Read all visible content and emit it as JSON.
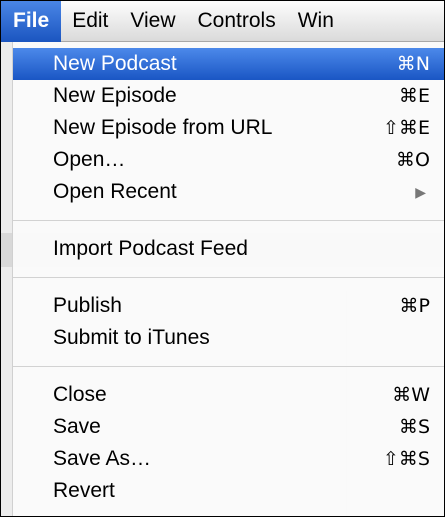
{
  "menubar": {
    "items": [
      {
        "label": "File",
        "active": true
      },
      {
        "label": "Edit",
        "active": false
      },
      {
        "label": "View",
        "active": false
      },
      {
        "label": "Controls",
        "active": false
      },
      {
        "label": "Win",
        "active": false
      }
    ]
  },
  "file_menu": {
    "groups": [
      [
        {
          "label": "New Podcast",
          "shortcut": "⌘N",
          "highlighted": true
        },
        {
          "label": "New Episode",
          "shortcut": "⌘E"
        },
        {
          "label": "New Episode from URL",
          "shortcut": "⇧⌘E"
        },
        {
          "label": "Open…",
          "shortcut": "⌘O"
        },
        {
          "label": "Open Recent",
          "submenu": true,
          "shortcut": "▶"
        }
      ],
      [
        {
          "label": "Import Podcast Feed",
          "shortcut": ""
        }
      ],
      [
        {
          "label": "Publish",
          "shortcut": "⌘P"
        },
        {
          "label": "Submit to iTunes",
          "shortcut": ""
        }
      ],
      [
        {
          "label": "Close",
          "shortcut": "⌘W"
        },
        {
          "label": "Save",
          "shortcut": "⌘S"
        },
        {
          "label": "Save As…",
          "shortcut": "⇧⌘S"
        },
        {
          "label": "Revert",
          "shortcut": ""
        }
      ]
    ]
  },
  "colors": {
    "highlight": "#1f5dc4",
    "menu_background": "#fafafa"
  }
}
